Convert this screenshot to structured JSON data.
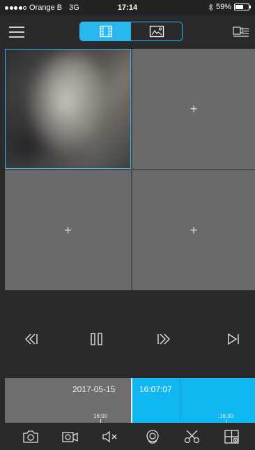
{
  "status_bar": {
    "carrier": "Orange B",
    "network": "3G",
    "time": "17:14",
    "battery_text": "59%",
    "battery_level": 0.59,
    "signal_bars_filled": 4,
    "signal_bars_total": 5
  },
  "nav": {
    "menu_icon": "hamburger-menu-icon",
    "segments": [
      {
        "icon": "film-strip-icon",
        "active": true
      },
      {
        "icon": "picture-icon",
        "active": false
      }
    ],
    "right_icon": "playlist-icon"
  },
  "grid": {
    "cells": [
      {
        "content": "video",
        "selected": true
      },
      {
        "content": "+",
        "selected": false
      },
      {
        "content": "+",
        "selected": false
      },
      {
        "content": "+",
        "selected": false
      }
    ]
  },
  "playback_controls": [
    {
      "icon": "rewind-icon"
    },
    {
      "icon": "pause-icon"
    },
    {
      "icon": "fast-forward-icon"
    },
    {
      "icon": "skip-next-icon"
    }
  ],
  "timeline": {
    "date": "2017-05-15",
    "current_time": "16:07:07",
    "ticks": [
      {
        "label": "16:00"
      },
      {
        "label": "16:30"
      }
    ]
  },
  "toolbar": [
    {
      "icon": "snapshot-camera-icon"
    },
    {
      "icon": "record-video-icon"
    },
    {
      "icon": "mute-speaker-icon"
    },
    {
      "icon": "search-playback-icon"
    },
    {
      "icon": "scissors-clip-icon"
    },
    {
      "icon": "window-layout-icon"
    }
  ],
  "colors": {
    "accent": "#29b7ef",
    "background": "#2a2a2c",
    "cell": "#6a6a6c"
  }
}
